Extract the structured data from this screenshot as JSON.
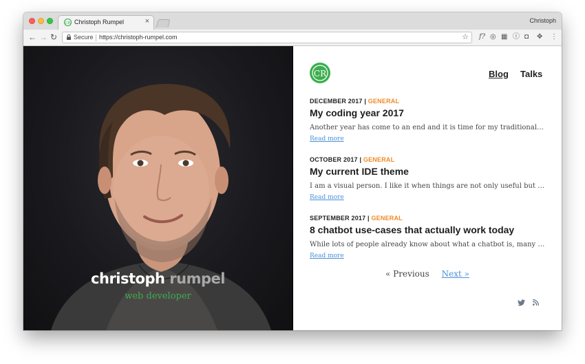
{
  "browser": {
    "tab_title": "Christoph Rumpel",
    "tab_close": "×",
    "profile_name": "Christoph",
    "secure_label": "Secure",
    "url": "https://christoph-rumpel.com"
  },
  "hero": {
    "first_name": "christoph",
    "last_name": "rumpel",
    "role": "web developer"
  },
  "nav": {
    "blog": "Blog",
    "talks": "Talks"
  },
  "posts": [
    {
      "date": "DECEMBER 2017",
      "category": "GENERAL",
      "title": "My coding year 2017",
      "excerpt": "Another year has come to an end and it is time for my traditional New Year's post where I look back at the year.",
      "read_more": "Read more"
    },
    {
      "date": "OCTOBER 2017",
      "category": "GENERAL",
      "title": "My current IDE theme",
      "excerpt": "I am a visual person. I like it when things are not only useful but beautiful too, and this is true for my IDE as well.",
      "read_more": "Read more"
    },
    {
      "date": "SEPTEMBER 2017",
      "category": "GENERAL",
      "title": "8 chatbot use-cases that actually work today",
      "excerpt": "While lots of people already know about what a chatbot is, many still have no idea what they can be used for.",
      "read_more": "Read more"
    }
  ],
  "pagination": {
    "previous": "« Previous",
    "next": "Next »"
  },
  "colors": {
    "accent_green": "#3cae4f",
    "category_orange": "#f08a24",
    "link_blue": "#4a90d9"
  },
  "icons": [
    "twitter-icon",
    "rss-icon"
  ]
}
